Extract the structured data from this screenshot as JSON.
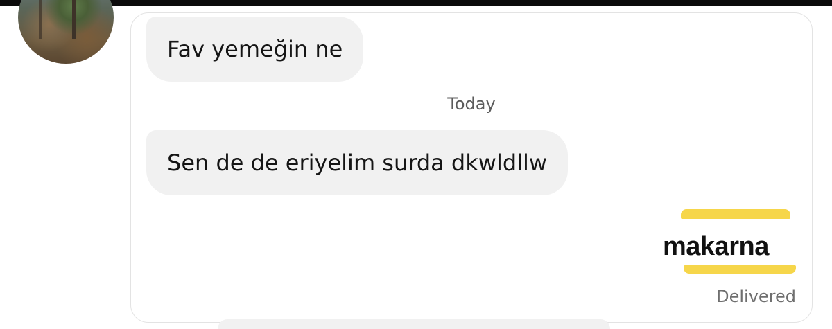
{
  "conversation": {
    "messages": [
      {
        "text": "Fav yemeğin ne"
      },
      {
        "text": "Sen de de eriyelim surda dkwldllw"
      }
    ],
    "date_divider": "Today",
    "sent_sticker": {
      "text": "makarna",
      "accent_color": "#f6d64a"
    },
    "status": "Delivered"
  },
  "colors": {
    "bubble": "#f1f1f1",
    "panel_border": "#e3e3e3",
    "text": "#151515",
    "muted": "#6f6f6f"
  }
}
